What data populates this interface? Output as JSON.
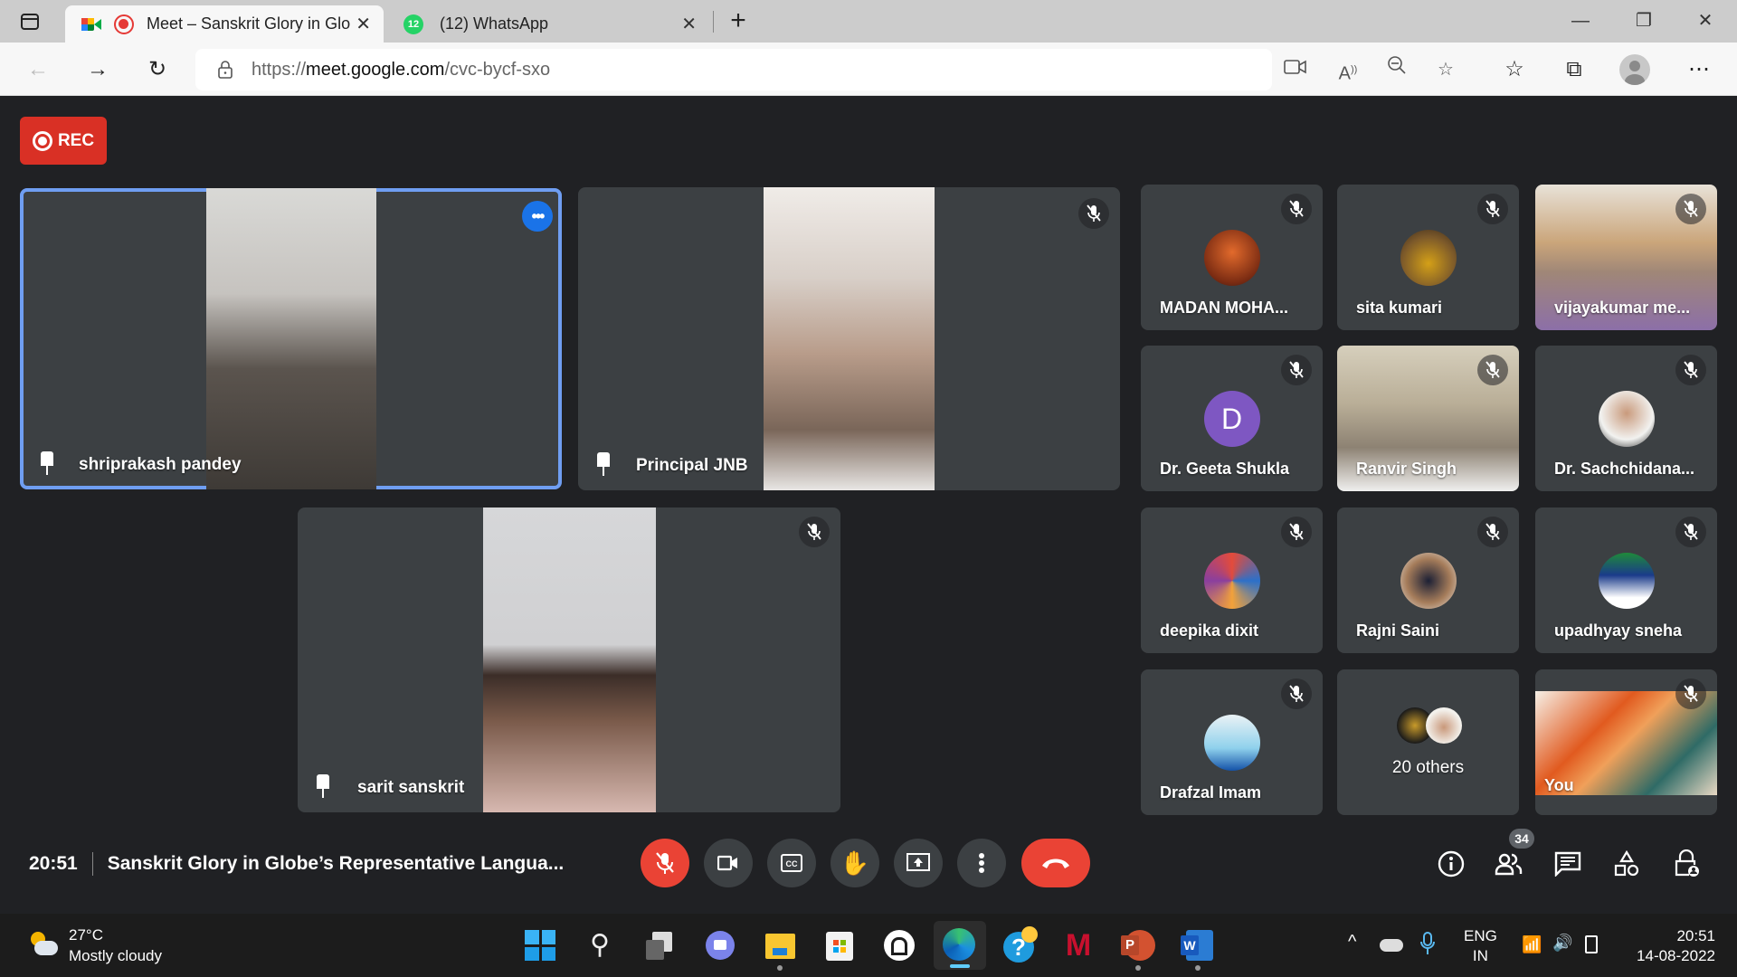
{
  "browser": {
    "tabs": [
      {
        "title": "Meet – Sanskrit Glory in Glo",
        "recording": true,
        "active": true
      },
      {
        "title": "(12) WhatsApp",
        "badge": "12",
        "active": false
      }
    ],
    "url_prefix": "https://",
    "url_host": "meet.google.com",
    "url_path": "/cvc-bycf-sxo",
    "icons": [
      "tab-actions-icon",
      "back-icon",
      "forward-icon",
      "refresh-icon",
      "lock-icon",
      "camera-icon",
      "read-aloud-icon",
      "zoom-out-icon",
      "add-favorite-icon",
      "favorites-icon",
      "collections-icon",
      "profile-icon",
      "more-icon",
      "minimize-icon",
      "maximize-icon",
      "close-icon",
      "new-tab-icon"
    ]
  },
  "meet": {
    "rec_label": "REC",
    "main_tiles": [
      {
        "name": "shriprakash pandey",
        "pinned": true,
        "active": true
      },
      {
        "name": "Principal JNB",
        "pinned": true,
        "muted": true
      },
      {
        "name": "sarit sanskrit",
        "pinned": true,
        "muted": true
      }
    ],
    "small_tiles": [
      {
        "name": "MADAN MOHA...",
        "muted": true
      },
      {
        "name": "sita kumari",
        "muted": true
      },
      {
        "name": "vijayakumar me...",
        "muted": true
      },
      {
        "name": "Dr. Geeta Shukla",
        "muted": true,
        "initial": "D"
      },
      {
        "name": "Ranvir Singh",
        "muted": true
      },
      {
        "name": "Dr. Sachchidana...",
        "muted": true
      },
      {
        "name": "deepika dixit",
        "muted": true
      },
      {
        "name": "Rajni Saini",
        "muted": true
      },
      {
        "name": "upadhyay sneha",
        "muted": true
      },
      {
        "name": "Drafzal Imam",
        "muted": true
      },
      {
        "name": "20 others"
      },
      {
        "name": "You",
        "muted": true
      }
    ],
    "time": "20:51",
    "meeting_title": "Sanskrit Glory in Globe’s Representative Langua...",
    "participant_count": "34",
    "colors": {
      "red": "#ea4335",
      "accent": "#1a73e8",
      "tile": "#3c4043",
      "bg": "#202124",
      "avatar_purple": "#7e57c2"
    }
  },
  "taskbar": {
    "weather_temp": "27°C",
    "weather_desc": "Mostly cloudy",
    "lang_line1": "ENG",
    "lang_line2": "IN",
    "clock_time": "20:51",
    "clock_date": "14-08-2022"
  }
}
